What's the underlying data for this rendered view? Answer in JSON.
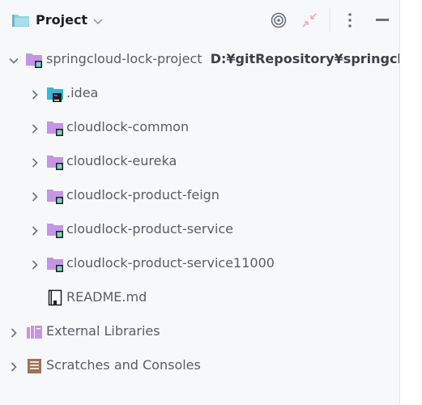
{
  "header": {
    "title": "Project",
    "icons": [
      "project-folder-icon",
      "chevron-down-icon",
      "locate-icon",
      "collapse-all-icon",
      "more-options-icon",
      "minimize-icon"
    ]
  },
  "colors": {
    "folder_purple": "#c594e6",
    "folder_teal": "#8fd4e0",
    "module_badge": "#7dd3c3",
    "idea_badge": "#1e1f22",
    "scratches_brown": "#a0715a",
    "libraries_purple": "#c594e6",
    "text": "#5a5d63"
  },
  "tree": {
    "root": {
      "label": "springcloud-lock-project",
      "path": "D:¥gitRepository¥springclo"
    },
    "children": [
      {
        "label": ".idea",
        "icon": "idea-folder-icon"
      },
      {
        "label": "cloudlock-common",
        "icon": "module-folder-icon"
      },
      {
        "label": "cloudlock-eureka",
        "icon": "module-folder-icon"
      },
      {
        "label": "cloudlock-product-feign",
        "icon": "module-folder-icon"
      },
      {
        "label": "cloudlock-product-service",
        "icon": "module-folder-icon"
      },
      {
        "label": "cloudlock-product-service11000",
        "icon": "module-folder-icon"
      }
    ],
    "readme": {
      "label": "README.md",
      "icon": "markdown-file-icon"
    },
    "external_libraries": {
      "label": "External Libraries"
    },
    "scratches": {
      "label": "Scratches and Consoles"
    }
  }
}
